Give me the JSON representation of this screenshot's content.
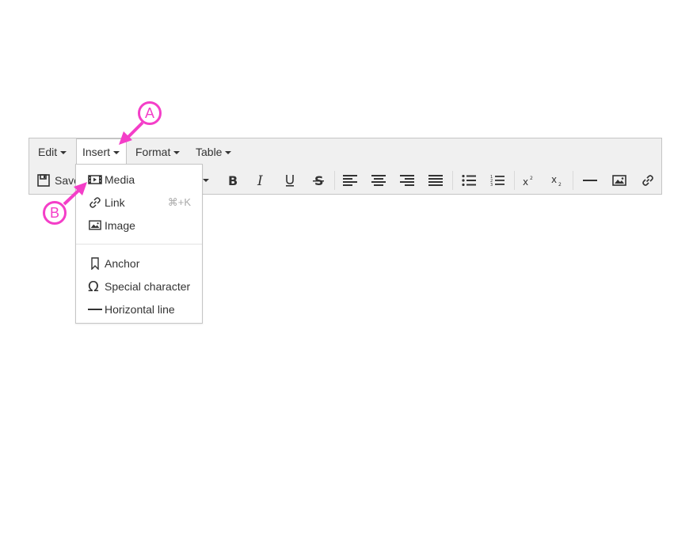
{
  "menubar": {
    "items": [
      {
        "label": "Edit"
      },
      {
        "label": "Insert"
      },
      {
        "label": "Format"
      },
      {
        "label": "Table"
      }
    ]
  },
  "toolbar": {
    "save_label": "Save",
    "buttons": [
      "save",
      "bold",
      "italic",
      "underline",
      "strikethrough",
      "align-left",
      "align-center",
      "align-right",
      "align-justify",
      "bullet-list",
      "numbered-list",
      "superscript",
      "subscript",
      "horizontal-line",
      "image",
      "link"
    ]
  },
  "insert_menu": {
    "items": [
      {
        "label": "Media",
        "icon": "media-icon"
      },
      {
        "label": "Link",
        "icon": "link-icon",
        "shortcut": "⌘+K"
      },
      {
        "label": "Image",
        "icon": "image-icon"
      },
      {
        "label": "Anchor",
        "icon": "bookmark-icon"
      },
      {
        "label": "Special character",
        "icon": "omega-icon"
      },
      {
        "label": "Horizontal line",
        "icon": "hr-icon"
      }
    ]
  },
  "annotations": {
    "a": "A",
    "b": "B",
    "color": "#f43ec8"
  }
}
